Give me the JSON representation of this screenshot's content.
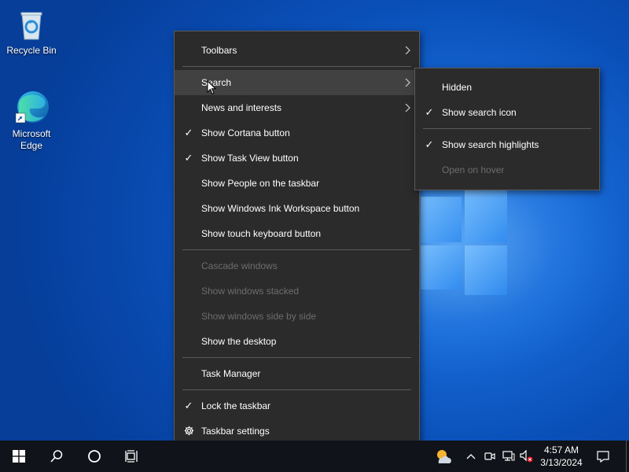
{
  "desktop": {
    "icons": [
      {
        "label": "Recycle Bin"
      },
      {
        "label": "Microsoft Edge"
      }
    ]
  },
  "context_menu": {
    "items": {
      "toolbars": "Toolbars",
      "search": "Search",
      "news": "News and interests",
      "cortana": "Show Cortana button",
      "taskview": "Show Task View button",
      "people": "Show People on the taskbar",
      "ink": "Show Windows Ink Workspace button",
      "touch_kb": "Show touch keyboard button",
      "cascade": "Cascade windows",
      "stacked": "Show windows stacked",
      "side_by_side": "Show windows side by side",
      "desktop": "Show the desktop",
      "task_manager": "Task Manager",
      "lock": "Lock the taskbar",
      "settings": "Taskbar settings"
    },
    "checked": [
      "cortana",
      "taskview",
      "lock"
    ]
  },
  "search_submenu": {
    "items": {
      "hidden": "Hidden",
      "show_icon": "Show search icon",
      "highlights": "Show search highlights",
      "open_hover": "Open on hover"
    }
  },
  "taskbar": {
    "clock_time": "4:57 AM",
    "clock_date": "3/13/2024"
  },
  "colors": {
    "menu_bg": "#2b2b2b",
    "menu_hover": "#414141",
    "disabled_text": "#6d6d6d",
    "taskbar_bg": "#101319"
  }
}
